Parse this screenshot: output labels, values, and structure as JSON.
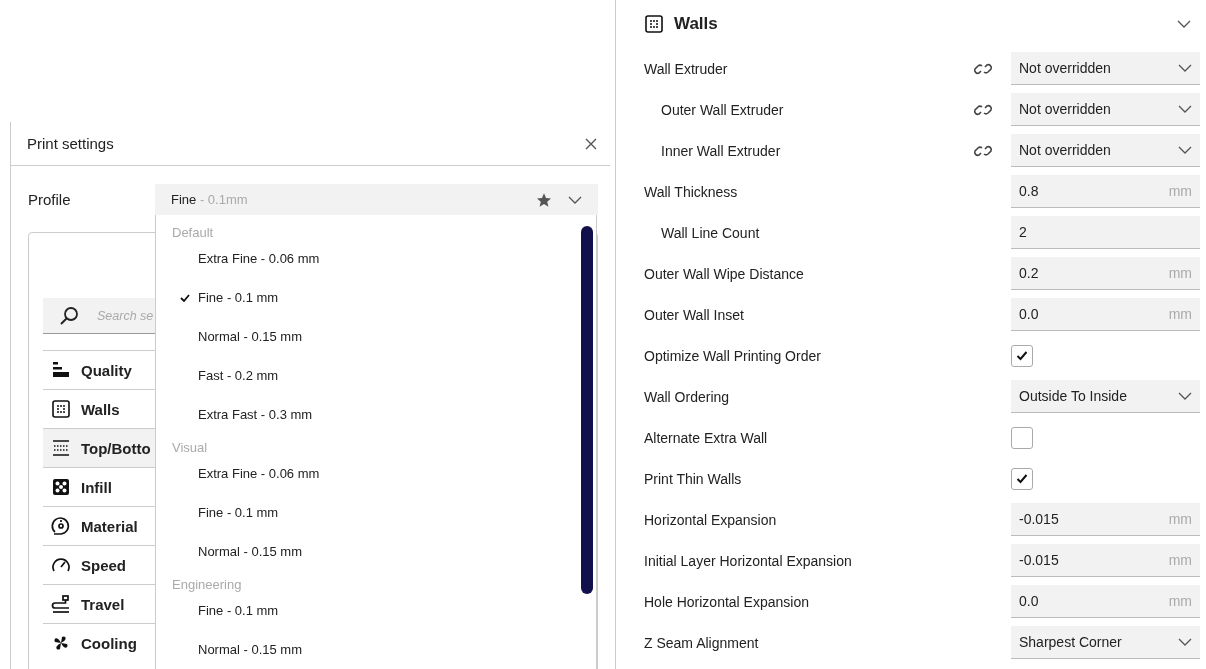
{
  "print_settings": {
    "title": "Print settings",
    "profile_label": "Profile",
    "profile_name": "Fine",
    "profile_detail": "- 0.1mm"
  },
  "search": {
    "placeholder": "Search se"
  },
  "categories": [
    {
      "label": "Quality",
      "selected": false
    },
    {
      "label": "Walls",
      "selected": false
    },
    {
      "label": "Top/Botto",
      "selected": true
    },
    {
      "label": "Infill",
      "selected": false
    },
    {
      "label": "Material",
      "selected": false
    },
    {
      "label": "Speed",
      "selected": false
    },
    {
      "label": "Travel",
      "selected": false
    },
    {
      "label": "Cooling",
      "selected": false
    }
  ],
  "profile_menu": [
    {
      "group": "Default",
      "items": [
        {
          "label": "Extra Fine - 0.06 mm",
          "checked": false
        },
        {
          "label": "Fine - 0.1 mm",
          "checked": true
        },
        {
          "label": "Normal - 0.15 mm",
          "checked": false
        },
        {
          "label": "Fast - 0.2 mm",
          "checked": false
        },
        {
          "label": "Extra Fast - 0.3 mm",
          "checked": false
        }
      ]
    },
    {
      "group": "Visual",
      "items": [
        {
          "label": "Extra Fine - 0.06 mm",
          "checked": false
        },
        {
          "label": "Fine - 0.1 mm",
          "checked": false
        },
        {
          "label": "Normal - 0.15 mm",
          "checked": false
        }
      ]
    },
    {
      "group": "Engineering",
      "items": [
        {
          "label": "Fine - 0.1 mm",
          "checked": false
        },
        {
          "label": "Normal - 0.15 mm",
          "checked": false
        }
      ]
    }
  ],
  "walls": {
    "title": "Walls",
    "settings": [
      {
        "kind": "dropdown",
        "label": "Wall Extruder",
        "indented": false,
        "linked": true,
        "value": "Not overridden"
      },
      {
        "kind": "dropdown",
        "label": "Outer Wall Extruder",
        "indented": true,
        "linked": true,
        "value": "Not overridden"
      },
      {
        "kind": "dropdown",
        "label": "Inner Wall Extruder",
        "indented": true,
        "linked": true,
        "value": "Not overridden"
      },
      {
        "kind": "number",
        "label": "Wall Thickness",
        "indented": false,
        "linked": false,
        "value": "0.8",
        "unit": "mm"
      },
      {
        "kind": "number",
        "label": "Wall Line Count",
        "indented": true,
        "linked": false,
        "value": "2"
      },
      {
        "kind": "number",
        "label": "Outer Wall Wipe Distance",
        "indented": false,
        "linked": false,
        "value": "0.2",
        "unit": "mm"
      },
      {
        "kind": "number",
        "label": "Outer Wall Inset",
        "indented": false,
        "linked": false,
        "value": "0.0",
        "unit": "mm"
      },
      {
        "kind": "checkbox",
        "label": "Optimize Wall Printing Order",
        "indented": false,
        "linked": false,
        "checked": true
      },
      {
        "kind": "dropdown",
        "label": "Wall Ordering",
        "indented": false,
        "linked": false,
        "value": "Outside To Inside"
      },
      {
        "kind": "checkbox",
        "label": "Alternate Extra Wall",
        "indented": false,
        "linked": false,
        "checked": false
      },
      {
        "kind": "checkbox",
        "label": "Print Thin Walls",
        "indented": false,
        "linked": false,
        "checked": true
      },
      {
        "kind": "number",
        "label": "Horizontal Expansion",
        "indented": false,
        "linked": false,
        "value": "-0.015",
        "unit": "mm"
      },
      {
        "kind": "number",
        "label": "Initial Layer Horizontal Expansion",
        "indented": false,
        "linked": false,
        "value": "-0.015",
        "unit": "mm"
      },
      {
        "kind": "number",
        "label": "Hole Horizontal Expansion",
        "indented": false,
        "linked": false,
        "value": "0.0",
        "unit": "mm"
      },
      {
        "kind": "dropdown",
        "label": "Z Seam Alignment",
        "indented": false,
        "linked": false,
        "value": "Sharpest Corner"
      }
    ]
  }
}
